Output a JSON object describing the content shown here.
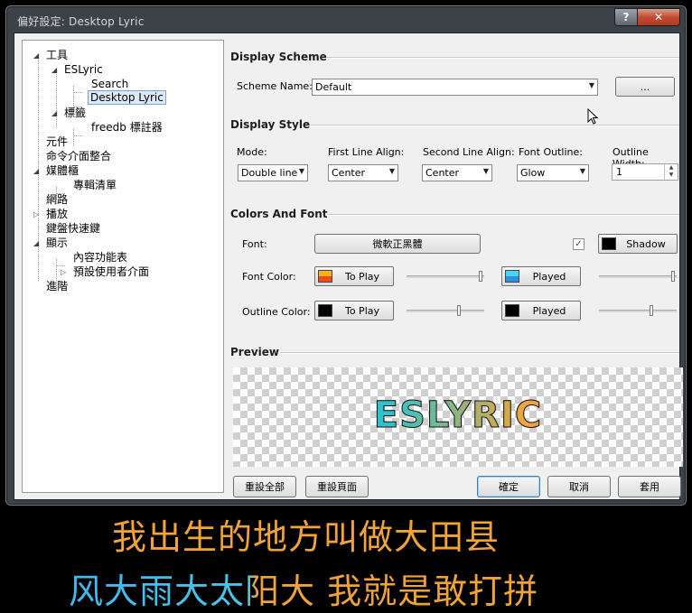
{
  "window": {
    "title": "偏好設定: Desktop Lyric",
    "help_label": "?",
    "close_label": "✕"
  },
  "tree": {
    "items": [
      {
        "label": "工具",
        "expander": "◢"
      },
      {
        "label": "ESLyric",
        "expander": "◢"
      },
      {
        "label": "Search"
      },
      {
        "label": "Desktop Lyric",
        "selected": true
      },
      {
        "label": "標籤",
        "expander": "◢"
      },
      {
        "label": "freedb 標註器"
      },
      {
        "label": "元件"
      },
      {
        "label": "命令介面整合"
      },
      {
        "label": "媒體櫃",
        "expander": "◢"
      },
      {
        "label": "專輯清單"
      },
      {
        "label": "網路"
      },
      {
        "label": "播放",
        "expander": "▷"
      },
      {
        "label": "鍵盤快速鍵"
      },
      {
        "label": "顯示",
        "expander": "◢"
      },
      {
        "label": "內容功能表"
      },
      {
        "label": "預設使用者介面",
        "expander": "▷"
      },
      {
        "label": "進階"
      }
    ]
  },
  "display_scheme": {
    "title": "Display Scheme",
    "scheme_name_label": "Scheme Name:",
    "scheme_name_value": "Default",
    "more_button": "..."
  },
  "display_style": {
    "title": "Display Style",
    "mode_label": "Mode:",
    "mode_value": "Double line",
    "first_align_label": "First Line Align:",
    "first_align_value": "Center",
    "second_align_label": "Second Line Align:",
    "second_align_value": "Center",
    "outline_label": "Font Outline:",
    "outline_value": "Glow",
    "outline_width_label": "Outline Width:",
    "outline_width_value": "1"
  },
  "colors_font": {
    "title": "Colors And Font",
    "font_label": "Font:",
    "font_button": "微軟正黑體",
    "shadow_checked": true,
    "shadow_label": "Shadow",
    "shadow_color": "#000000",
    "font_color_label": "Font Color:",
    "to_play_label": "To Play",
    "to_play_colors": [
      "#f7b21e",
      "#f04a18"
    ],
    "played_label": "Played",
    "played_colors": [
      "#48d6f0",
      "#2f8fe0"
    ],
    "font_to_play_slider": 1.0,
    "font_played_slider": 1.0,
    "outline_color_label": "Outline Color:",
    "outline_to_play_label": "To Play",
    "outline_to_play_color": "#000000",
    "outline_played_label": "Played",
    "outline_played_color": "#000000",
    "outline_to_play_slider": 0.68,
    "outline_played_slider": 0.68
  },
  "preview": {
    "title": "Preview",
    "text": "ESLYRIC"
  },
  "footer": {
    "reset_all": "重設全部",
    "reset_page": "重設頁面",
    "ok": "確定",
    "cancel": "取消",
    "apply": "套用"
  },
  "desktop_lyric": {
    "line1": "我出生的地方叫做大田县",
    "line2": "风大雨大太阳大 我就是敢打拼"
  }
}
